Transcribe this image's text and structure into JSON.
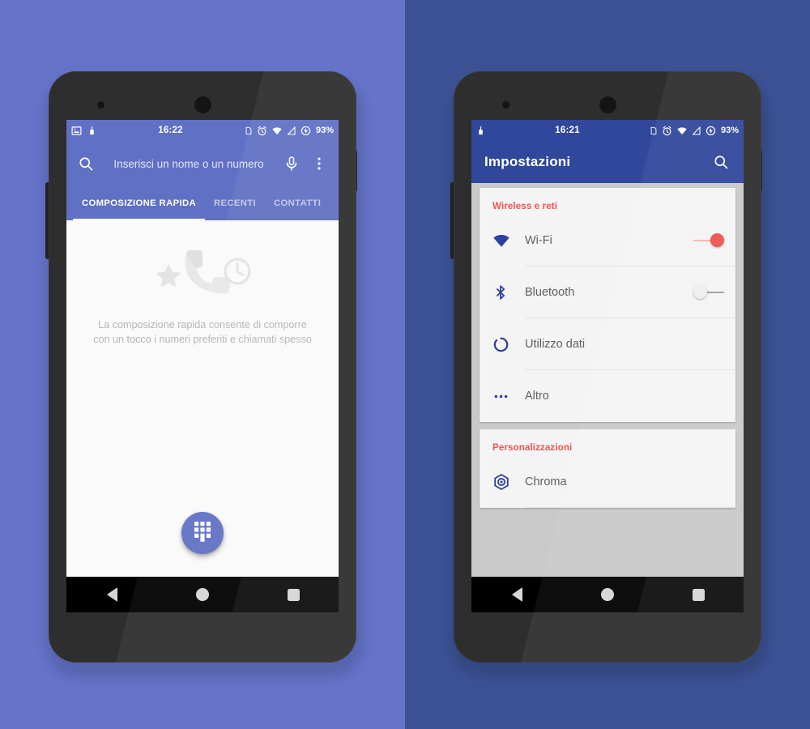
{
  "background": {
    "left_color": "#6573c9",
    "right_color": "#3c5295"
  },
  "phones": [
    {
      "id": "dialer-phone",
      "statusbar": {
        "time": "16:22",
        "battery": "93%",
        "left_icons": [
          "screenshot-icon",
          "vibrate-icon"
        ],
        "right_icons": [
          "sim-card-icon",
          "alarm-icon",
          "wifi-icon",
          "signal-icon",
          "charging-icon"
        ]
      },
      "app": {
        "name": "dialer",
        "accent_color": "#6070c4",
        "search": {
          "placeholder": "Inserisci un nome o un numero",
          "value": "",
          "search_icon": "search-icon",
          "voice_icon": "microphone-icon",
          "overflow_icon": "more-vert-icon"
        },
        "tabs": [
          {
            "label": "COMPOSIZIONE RAPIDA",
            "active": true
          },
          {
            "label": "RECENTI",
            "active": false
          },
          {
            "label": "CONTATTI",
            "active": false
          }
        ],
        "empty_state": {
          "art_icons": [
            "star-icon",
            "phone-handset-icon",
            "clock-icon"
          ],
          "message": "La composizione rapida consente di comporre con un tocco i numeri preferiti e chiamati spesso"
        },
        "fab": {
          "icon": "dialpad-icon",
          "color": "#6070c4"
        }
      },
      "navbar": {
        "back": "back-icon",
        "home": "home-icon",
        "recents": "recents-icon"
      }
    },
    {
      "id": "settings-phone",
      "statusbar": {
        "time": "16:21",
        "battery": "93%",
        "left_icons": [
          "vibrate-icon"
        ],
        "right_icons": [
          "sim-card-icon",
          "alarm-icon",
          "wifi-icon",
          "signal-icon",
          "charging-icon"
        ]
      },
      "app": {
        "name": "settings",
        "accent_color": "#31479c",
        "title": "Impostazioni",
        "search_icon": "search-icon",
        "section_color": "#ef5350",
        "sections": [
          {
            "header": "Wireless e reti",
            "rows": [
              {
                "icon": "wifi-icon",
                "label": "Wi-Fi",
                "control": "toggle",
                "toggle_state": "on"
              },
              {
                "icon": "bluetooth-icon",
                "label": "Bluetooth",
                "control": "toggle",
                "toggle_state": "off"
              },
              {
                "icon": "data-usage-icon",
                "label": "Utilizzo dati",
                "control": "none"
              },
              {
                "icon": "more-horiz-icon",
                "label": "Altro",
                "control": "none"
              }
            ]
          },
          {
            "header": "Personalizzazioni",
            "rows": [
              {
                "icon": "chroma-gear-icon",
                "label": "Chroma",
                "control": "none"
              }
            ]
          }
        ]
      },
      "navbar": {
        "back": "back-icon",
        "home": "home-icon",
        "recents": "recents-icon"
      }
    }
  ]
}
